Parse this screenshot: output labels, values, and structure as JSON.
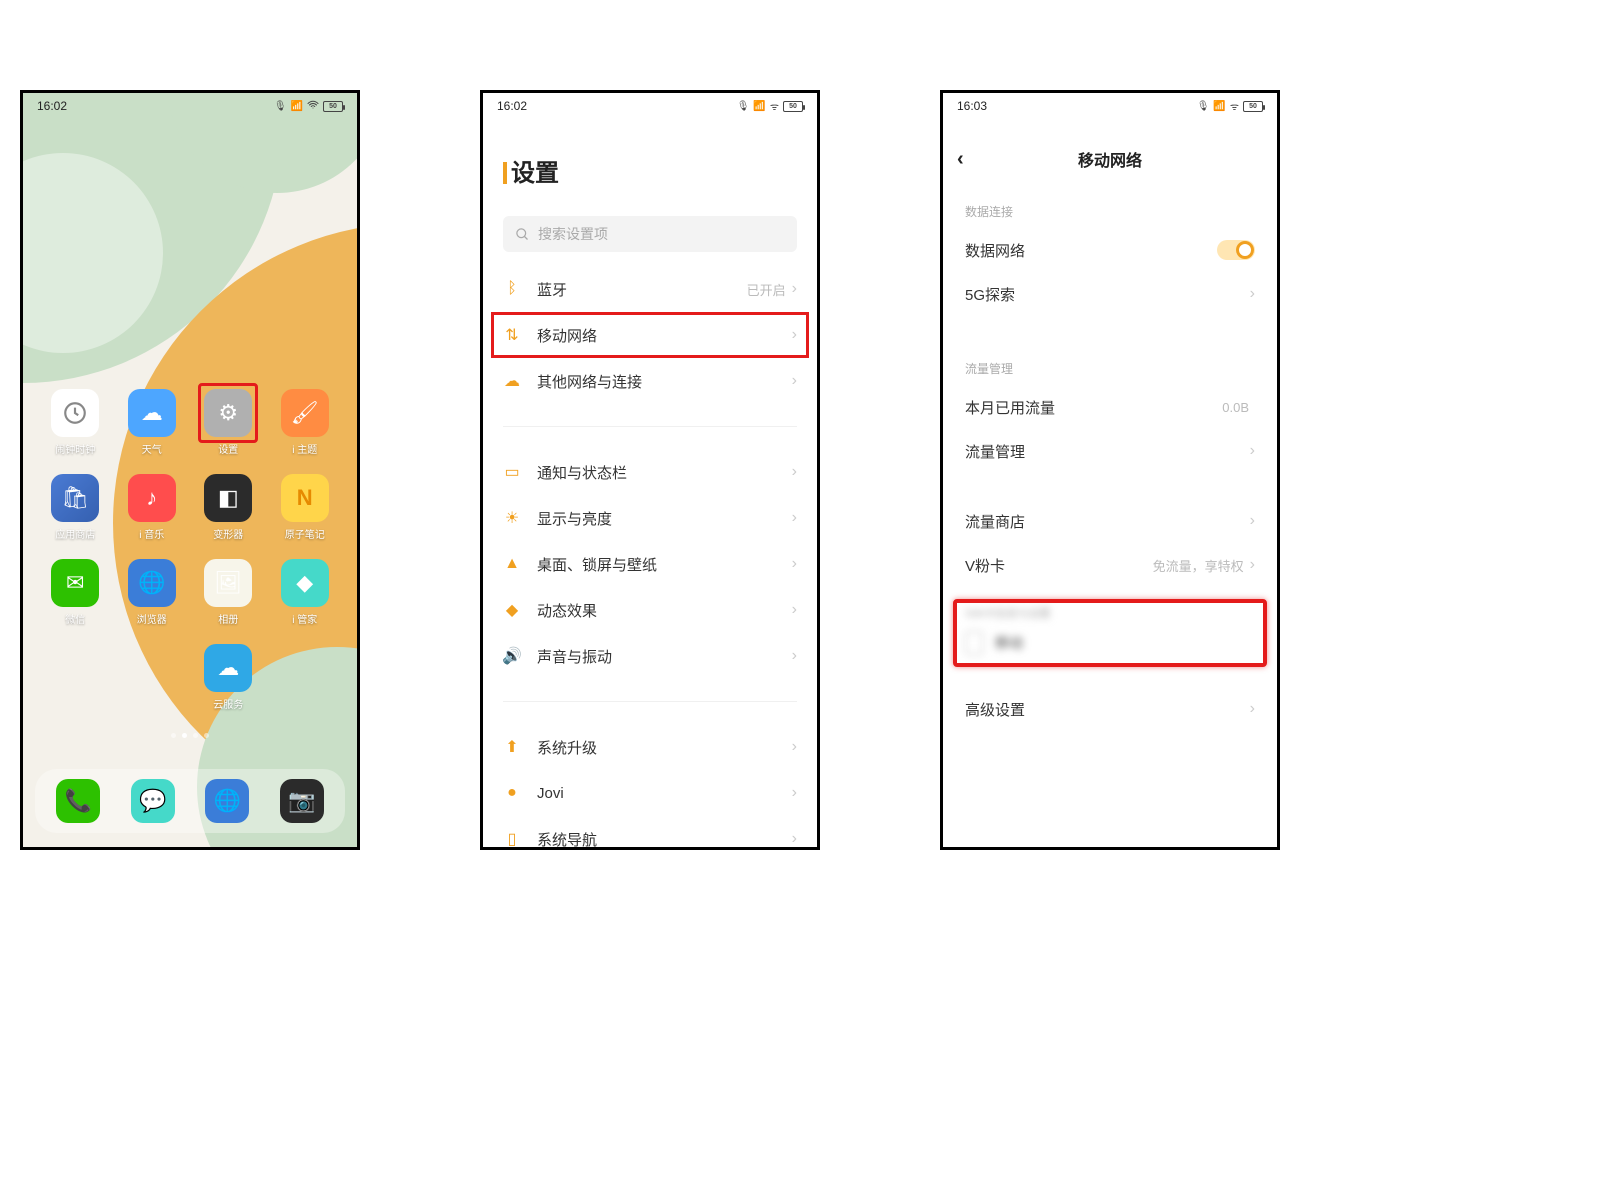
{
  "status": {
    "time1": "16:02",
    "time2": "16:02",
    "time3": "16:03",
    "battery": "50"
  },
  "home": {
    "apps": [
      {
        "label": "闹钟时钟",
        "icon": "clock"
      },
      {
        "label": "天气",
        "icon": "weather"
      },
      {
        "label": "设置",
        "icon": "settings",
        "highlight": true
      },
      {
        "label": "i 主题",
        "icon": "theme"
      },
      {
        "label": "应用商店",
        "icon": "store"
      },
      {
        "label": "i 音乐",
        "icon": "music"
      },
      {
        "label": "变形器",
        "icon": "transform"
      },
      {
        "label": "原子笔记",
        "icon": "notes"
      },
      {
        "label": "微信",
        "icon": "wechat"
      },
      {
        "label": "浏览器",
        "icon": "browser"
      },
      {
        "label": "相册",
        "icon": "gallery"
      },
      {
        "label": "i 管家",
        "icon": "manager"
      },
      {
        "label": "云服务",
        "icon": "cloud"
      }
    ],
    "dock": [
      "phone",
      "msg",
      "earth",
      "camera"
    ]
  },
  "settings": {
    "title": "设置",
    "search_placeholder": "搜索设置项",
    "items": {
      "bluetooth": {
        "label": "蓝牙",
        "value": "已开启"
      },
      "mobile": {
        "label": "移动网络"
      },
      "other_net": {
        "label": "其他网络与连接"
      },
      "notif": {
        "label": "通知与状态栏"
      },
      "display": {
        "label": "显示与亮度"
      },
      "desktop": {
        "label": "桌面、锁屏与壁纸"
      },
      "motion": {
        "label": "动态效果"
      },
      "sound": {
        "label": "声音与振动"
      },
      "upgrade": {
        "label": "系统升级"
      },
      "jovi": {
        "label": "Jovi"
      },
      "nav": {
        "label": "系统导航"
      }
    }
  },
  "network": {
    "title": "移动网络",
    "sec_data": "数据连接",
    "data_net": "数据网络",
    "five_g": "5G探索",
    "sec_traffic": "流量管理",
    "month_used": {
      "label": "本月已用流量",
      "value": "0.0B"
    },
    "traffic_mgr": "流量管理",
    "traffic_store": "流量商店",
    "vcard": {
      "label": "V粉卡",
      "value": "免流量，享特权"
    },
    "sim_section": "SIM卡信息与设置",
    "sim_name": "移动",
    "sim_sub": "",
    "advanced": "高级设置"
  }
}
